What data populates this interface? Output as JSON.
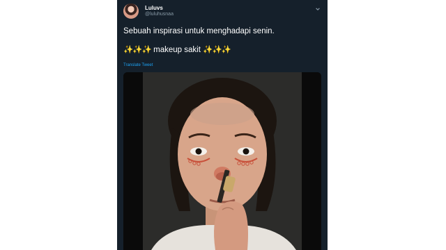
{
  "user": {
    "display_name": "Luluvs",
    "handle": "@luluhusnaa"
  },
  "tweet": {
    "text_line1": "Sebuah inspirasi untuk menghadapi senin.",
    "sparkles_left": "✨✨✨",
    "text_line2_word": " makeup sakit ",
    "sparkles_right": "✨✨✨",
    "translate_label": "Translate Tweet"
  },
  "media": {
    "type": "video",
    "icon": "video-frame"
  },
  "icons": {
    "caret": "chevron-down-icon"
  },
  "colors": {
    "card_background": "#15202b",
    "link": "#1da1f2",
    "secondary_text": "#8899a6"
  }
}
